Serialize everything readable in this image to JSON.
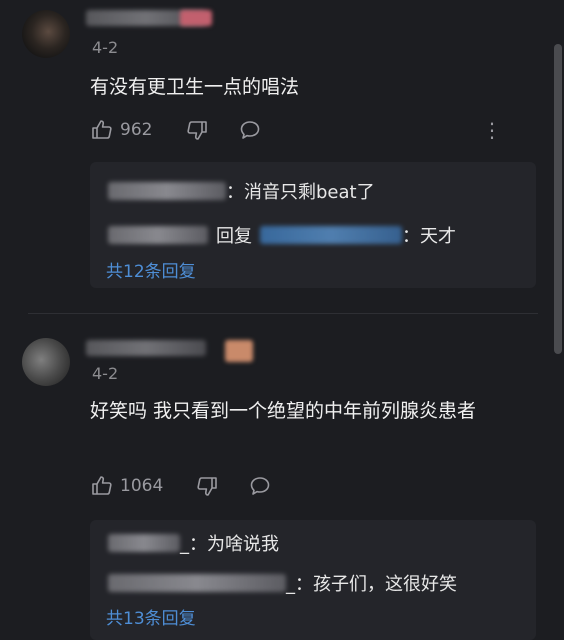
{
  "comments": [
    {
      "date": "4-2",
      "content": "有没有更卫生一点的唱法",
      "likes": "962",
      "replies": [
        {
          "text": "：消音只剩beat了"
        },
        {
          "reply_label": "回复",
          "text": "：天才"
        }
      ],
      "more_replies": "共12条回复"
    },
    {
      "date": "4-2",
      "content": "好笑吗 我只看到一个绝望的中年前列腺炎患者",
      "likes": "1064",
      "replies": [
        {
          "text": "_：为啥说我"
        },
        {
          "text": "_：孩子们，这很好笑"
        }
      ],
      "more_replies": "共13条回复"
    }
  ],
  "icons": {
    "like": "thumbs-up-icon",
    "dislike": "thumbs-down-icon",
    "reply": "comment-icon",
    "more": "more-vertical-icon"
  },
  "colors": {
    "background": "#1c1d21",
    "reply_panel": "#24252a",
    "link": "#4e8ed6",
    "muted": "#8c8c90"
  }
}
